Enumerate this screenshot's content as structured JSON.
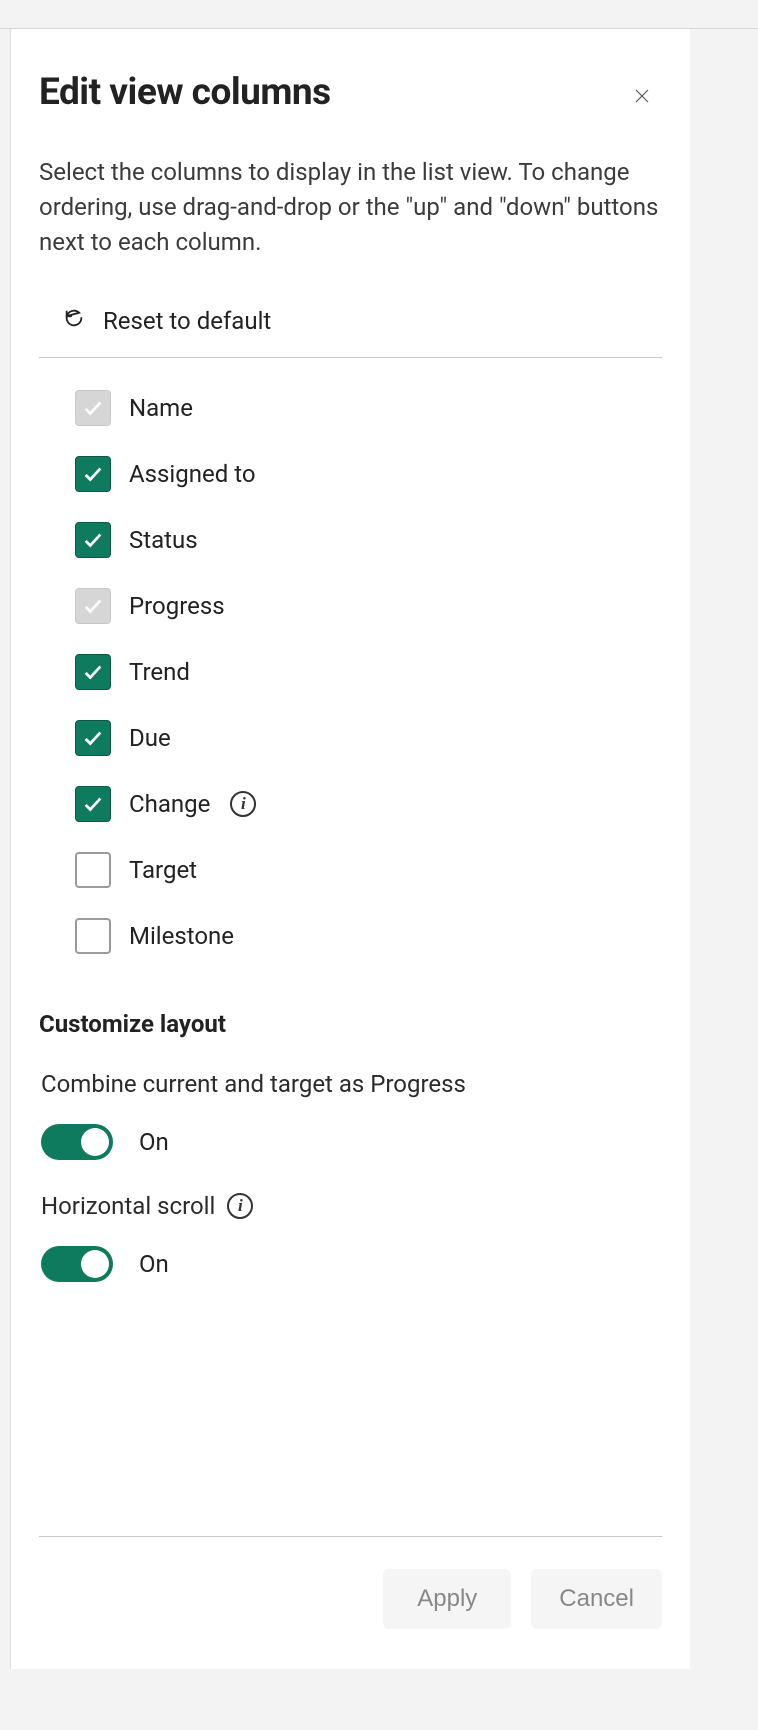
{
  "panel": {
    "title": "Edit view columns",
    "description": "Select the columns to display in the list view. To change ordering, use drag-and-drop or the \"up\" and \"down\" buttons next to each column.",
    "reset_label": "Reset to default"
  },
  "columns": [
    {
      "label": "Name",
      "state": "locked",
      "info": false
    },
    {
      "label": "Assigned to",
      "state": "checked",
      "info": false
    },
    {
      "label": "Status",
      "state": "checked",
      "info": false
    },
    {
      "label": "Progress",
      "state": "locked",
      "info": false
    },
    {
      "label": "Trend",
      "state": "checked",
      "info": false
    },
    {
      "label": "Due",
      "state": "checked",
      "info": false
    },
    {
      "label": "Change",
      "state": "checked",
      "info": true
    },
    {
      "label": "Target",
      "state": "unchecked",
      "info": false
    },
    {
      "label": "Milestone",
      "state": "unchecked",
      "info": false
    }
  ],
  "layout": {
    "section_title": "Customize layout",
    "settings": [
      {
        "label": "Combine current and target as Progress",
        "info": false,
        "on": true,
        "state_label": "On"
      },
      {
        "label": "Horizontal scroll",
        "info": true,
        "on": true,
        "state_label": "On"
      }
    ]
  },
  "footer": {
    "apply": "Apply",
    "cancel": "Cancel"
  }
}
